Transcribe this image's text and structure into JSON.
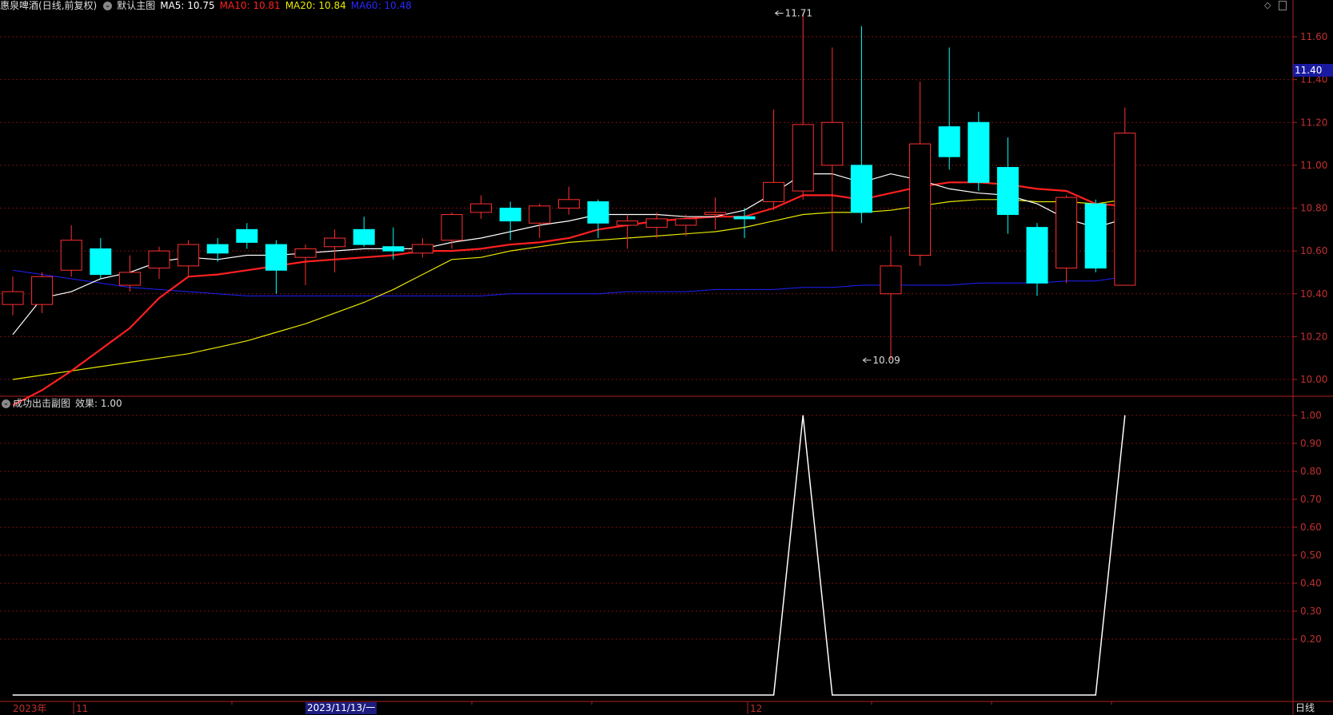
{
  "header": {
    "stock_name": "惠泉啤酒",
    "period": "(日线,前复权)",
    "main_chart_label": "默认主图",
    "ma5": "MA5: 10.75",
    "ma10": "MA10: 10.81",
    "ma20": "MA20: 10.84",
    "ma60": "MA60: 10.48",
    "colors": {
      "ma5": "#ffffff",
      "ma10": "#ff2020",
      "ma20": "#e8e800",
      "ma60": "#2020ff"
    }
  },
  "sub_header": {
    "indicator": "成功出击副图",
    "value": "效果: 1.00"
  },
  "current_price": "11.40",
  "bottom_axis": {
    "year_label": "2023年",
    "nov_label": "11",
    "dec_label": "12",
    "cursor_date": "2023/11/13/一",
    "period_button": "日线"
  },
  "chart_data": [
    {
      "type": "candlestick",
      "yticks": [
        "11.60",
        "11.40",
        "11.20",
        "11.00",
        "10.80",
        "10.60",
        "10.40",
        "10.20",
        "10.00"
      ],
      "ylim": [
        9.92,
        11.78
      ],
      "annotations": [
        {
          "text": "11.71",
          "price": 11.71,
          "index": 26
        },
        {
          "text": "10.09",
          "price": 10.09,
          "index": 29
        }
      ],
      "up_color": "#ff3030",
      "down_color": "#00ffff",
      "candles": [
        {
          "o": 10.35,
          "c": 10.41,
          "h": 10.48,
          "l": 10.3
        },
        {
          "o": 10.35,
          "c": 10.48,
          "h": 10.5,
          "l": 10.31
        },
        {
          "o": 10.51,
          "c": 10.65,
          "h": 10.72,
          "l": 10.48
        },
        {
          "o": 10.61,
          "c": 10.49,
          "h": 10.66,
          "l": 10.47
        },
        {
          "o": 10.44,
          "c": 10.5,
          "h": 10.58,
          "l": 10.41
        },
        {
          "o": 10.52,
          "c": 10.6,
          "h": 10.62,
          "l": 10.47
        },
        {
          "o": 10.53,
          "c": 10.63,
          "h": 10.65,
          "l": 10.48
        },
        {
          "o": 10.63,
          "c": 10.59,
          "h": 10.66,
          "l": 10.55
        },
        {
          "o": 10.7,
          "c": 10.64,
          "h": 10.73,
          "l": 10.61
        },
        {
          "o": 10.63,
          "c": 10.51,
          "h": 10.65,
          "l": 10.4
        },
        {
          "o": 10.57,
          "c": 10.61,
          "h": 10.63,
          "l": 10.44
        },
        {
          "o": 10.62,
          "c": 10.66,
          "h": 10.7,
          "l": 10.5
        },
        {
          "o": 10.7,
          "c": 10.63,
          "h": 10.76,
          "l": 10.62
        },
        {
          "o": 10.62,
          "c": 10.6,
          "h": 10.71,
          "l": 10.56
        },
        {
          "o": 10.59,
          "c": 10.63,
          "h": 10.66,
          "l": 10.57
        },
        {
          "o": 10.65,
          "c": 10.77,
          "h": 10.78,
          "l": 10.61
        },
        {
          "o": 10.78,
          "c": 10.82,
          "h": 10.86,
          "l": 10.75
        },
        {
          "o": 10.8,
          "c": 10.74,
          "h": 10.83,
          "l": 10.65
        },
        {
          "o": 10.73,
          "c": 10.81,
          "h": 10.82,
          "l": 10.66
        },
        {
          "o": 10.8,
          "c": 10.84,
          "h": 10.9,
          "l": 10.77
        },
        {
          "o": 10.83,
          "c": 10.73,
          "h": 10.84,
          "l": 10.66
        },
        {
          "o": 10.72,
          "c": 10.74,
          "h": 10.77,
          "l": 10.61
        },
        {
          "o": 10.71,
          "c": 10.75,
          "h": 10.78,
          "l": 10.66
        },
        {
          "o": 10.72,
          "c": 10.75,
          "h": 10.77,
          "l": 10.67
        },
        {
          "o": 10.77,
          "c": 10.78,
          "h": 10.85,
          "l": 10.7
        },
        {
          "o": 10.76,
          "c": 10.75,
          "h": 10.8,
          "l": 10.66
        },
        {
          "o": 10.83,
          "c": 10.92,
          "h": 11.26,
          "l": 10.79
        },
        {
          "o": 10.88,
          "c": 11.19,
          "h": 11.71,
          "l": 10.84
        },
        {
          "o": 11.0,
          "c": 11.2,
          "h": 11.55,
          "l": 10.6
        },
        {
          "o": 11.0,
          "c": 10.78,
          "h": 11.65,
          "l": 10.73
        },
        {
          "o": 10.4,
          "c": 10.53,
          "h": 10.67,
          "l": 10.09
        },
        {
          "o": 10.58,
          "c": 11.1,
          "h": 11.39,
          "l": 10.53
        },
        {
          "o": 11.18,
          "c": 11.04,
          "h": 11.55,
          "l": 10.98
        },
        {
          "o": 11.2,
          "c": 10.92,
          "h": 11.25,
          "l": 10.88
        },
        {
          "o": 10.99,
          "c": 10.77,
          "h": 11.13,
          "l": 10.68
        },
        {
          "o": 10.71,
          "c": 10.45,
          "h": 10.73,
          "l": 10.39
        },
        {
          "o": 10.52,
          "c": 10.85,
          "h": 10.86,
          "l": 10.45
        },
        {
          "o": 10.82,
          "c": 10.52,
          "h": 10.84,
          "l": 10.5
        },
        {
          "o": 10.44,
          "c": 11.15,
          "h": 11.27,
          "l": 10.44
        }
      ],
      "ma5": [
        10.21,
        10.38,
        10.41,
        10.47,
        10.5,
        10.55,
        10.57,
        10.56,
        10.58,
        10.58,
        10.59,
        10.6,
        10.61,
        10.61,
        10.61,
        10.64,
        10.66,
        10.69,
        10.72,
        10.74,
        10.77,
        10.77,
        10.77,
        10.76,
        10.76,
        10.79,
        10.87,
        10.96,
        10.96,
        10.92,
        10.96,
        10.93,
        10.89,
        10.87,
        10.86,
        10.82,
        10.75,
        10.71,
        10.75
      ],
      "ma10": [
        9.88,
        9.95,
        10.04,
        10.14,
        10.24,
        10.38,
        10.48,
        10.49,
        10.51,
        10.53,
        10.55,
        10.56,
        10.57,
        10.58,
        10.6,
        10.6,
        10.61,
        10.63,
        10.64,
        10.66,
        10.7,
        10.72,
        10.74,
        10.75,
        10.76,
        10.76,
        10.8,
        10.86,
        10.86,
        10.84,
        10.87,
        10.9,
        10.92,
        10.92,
        10.91,
        10.89,
        10.88,
        10.82,
        10.81
      ],
      "ma20": [
        10.0,
        10.02,
        10.04,
        10.06,
        10.08,
        10.1,
        10.12,
        10.15,
        10.18,
        10.22,
        10.26,
        10.31,
        10.36,
        10.42,
        10.49,
        10.56,
        10.57,
        10.6,
        10.62,
        10.64,
        10.65,
        10.66,
        10.67,
        10.68,
        10.69,
        10.71,
        10.74,
        10.77,
        10.78,
        10.78,
        10.79,
        10.81,
        10.83,
        10.84,
        10.84,
        10.83,
        10.83,
        10.82,
        10.84
      ],
      "ma60": [
        10.51,
        10.49,
        10.47,
        10.45,
        10.43,
        10.42,
        10.41,
        10.4,
        10.39,
        10.39,
        10.39,
        10.39,
        10.39,
        10.39,
        10.39,
        10.39,
        10.39,
        10.4,
        10.4,
        10.4,
        10.4,
        10.41,
        10.41,
        10.41,
        10.42,
        10.42,
        10.42,
        10.43,
        10.43,
        10.44,
        10.44,
        10.44,
        10.44,
        10.45,
        10.45,
        10.45,
        10.46,
        10.46,
        10.48
      ]
    },
    {
      "type": "line",
      "yticks": [
        "1.00",
        "0.90",
        "0.80",
        "0.70",
        "0.60",
        "0.50",
        "0.40",
        "0.30",
        "0.20"
      ],
      "ylim": [
        0,
        1.0
      ],
      "line_color": "#ffffff",
      "values": [
        0,
        0,
        0,
        0,
        0,
        0,
        0,
        0,
        0,
        0,
        0,
        0,
        0,
        0,
        0,
        0,
        0,
        0,
        0,
        0,
        0,
        0,
        0,
        0,
        0,
        0,
        0,
        1,
        0,
        0,
        0,
        0,
        0,
        0,
        0,
        0,
        0,
        0,
        1
      ]
    }
  ]
}
